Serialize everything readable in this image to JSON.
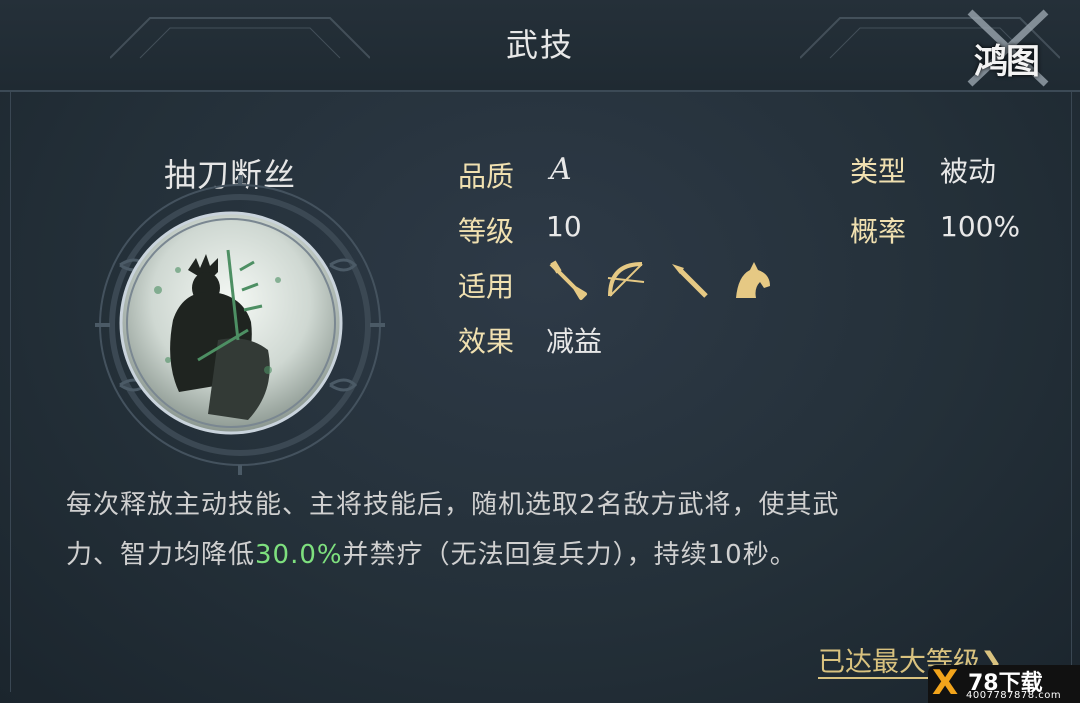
{
  "header": {
    "title": "武技"
  },
  "logo": {
    "text": "鸿图"
  },
  "skill": {
    "name": "抽刀断丝",
    "stats_left": [
      {
        "label": "品质",
        "value": "A"
      },
      {
        "label": "等级",
        "value": "10"
      },
      {
        "label": "适用",
        "value": ""
      },
      {
        "label": "效果",
        "value": "减益"
      }
    ],
    "stats_right": [
      {
        "label": "类型",
        "value": "被动"
      },
      {
        "label": "概率",
        "value": "100%"
      }
    ],
    "applicable_icons": [
      "sword-icon",
      "bow-icon",
      "spear-icon",
      "horse-icon"
    ],
    "description": {
      "part1": "每次释放主动技能、主将技能后，随机选取2名敌方武将，使其武",
      "part2": "力、智力均降低",
      "highlight": "30.0%",
      "part3": "并禁疗（无法回复兵力），持续10秒。"
    },
    "highlight_color": "#7ee07e"
  },
  "footer": {
    "max_level_link": "已达最大等级"
  },
  "watermark": {
    "brand": "X",
    "name": "78下载",
    "phone": "4007787878.com"
  },
  "colors": {
    "label": "#f0e0b0",
    "icon_gold": "#e6c984",
    "link": "#d9c27f"
  }
}
